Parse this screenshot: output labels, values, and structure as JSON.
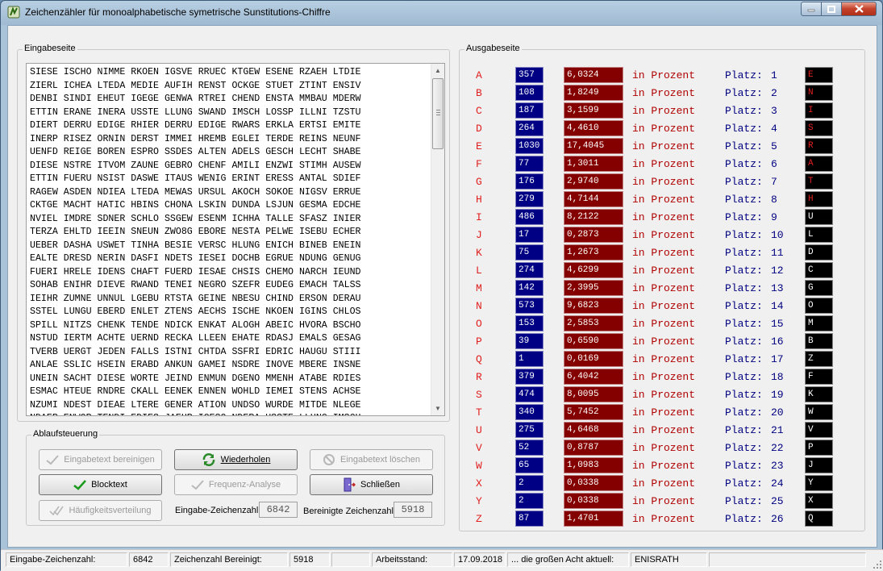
{
  "window": {
    "title": "Zeichenzähler für monoalphabetische symetrische Sunstitutions-Chiffre"
  },
  "input_panel": {
    "legend": "Eingabeseite",
    "lines": [
      "SIESE ISCHO NIMME RKOEN IGSVE RRUEC KTGEW ESENE RZAEH LTDIE",
      "ZIERL ICHEA LTEDA MEDIE AUFIH RENST OCKGE STUET ZTINT ENSIV",
      "DENBI SINDI EHEUT IGEGE GENWA RTREI CHEND ENSTA MMBAU MDERW",
      "ETTIN ERANE INERA USSTE LLUNG SWAND IMSCH LOSSP ILLNI TZSTU",
      "DIERT DERRU EDIGE RHIER DERRU EDIGE RWARS ERKLA ERTSI EMITE",
      "INERP RISEZ ORNIN DERST IMMEI HREMB EGLEI TERDE REINS NEUNF",
      "UENFD REIGE BOREN ESPRO SSDES ALTEN ADELS GESCH LECHT SHABE",
      "DIESE NSTRE ITVOM ZAUNE GEBRO CHENF AMILI ENZWI STIMH AUSEW",
      "ETTIN FUERU NSIST DASWE ITAUS WENIG ERINT ERESS ANTAL SDIEF",
      "RAGEW ASDEN NDIEA LTEDA MEWAS URSUL AKOCH SOKOE NIGSV ERRUE",
      "CKTGE MACHT HATIC HBINS CHONA LSKIN DUNDA LSJUN GESMA EDCHE",
      "NVIEL IMDRE SDNER SCHLO SSGEW ESENM ICHHA TALLE SFASZ INIER",
      "TERZA EHLTD IEEIN SNEUN ZWO8G EBORE NESTA PELWE ISEBU ECHER",
      "UEBER DASHA USWET TINHA BESIE VERSC HLUNG ENICH BINEB ENEIN",
      "EALTE DRESD NERIN DASFI NDETS IESEI DOCHB EGRUE NDUNG GENUG",
      "FUERI HRELE IDENS CHAFT FUERD IESAE CHSIS CHEMO NARCH IEUND",
      "SOHAB ENIHR DIEVE RWAND TENEI NEGRO SZEFR EUDEG EMACH TALSS",
      "IEIHR ZUMNE UNNUL LGEBU RTSTA GEINE NBESU CHIND ERSON DERAU",
      "SSTEL LUNGU EBERD ENLET ZTENS AECHS ISCHE NKOEN IGINS CHLOS",
      "SPILL NITZS CHENK TENDE NDICK ENKAT ALOGH ABEIC HVORA BSCHO",
      "NSTUD IERTM ACHTE UERND RECKA LLEEN EHATE RDASJ EMALS GESAG",
      "TVERB UERGT JEDEN FALLS ISTNI CHTDA SSFRI EDRIC HAUGU STIII",
      "ANLAE SSLIC HSEIN ERABD ANKUN GAMEI NSDRE INOVE MBERE INSNE",
      "UNEIN SACHT DIESE WORTE JEIND ENMUN DGENO MMENH ATABE RDIES",
      "ESMAC HTEUE RNDRE CKALL EENEK ENNEN WOHLD IEMEI STENS ACHSE",
      "NZUMI NDEST DIEAE LTERE GENER ATION UNDSO WURDE MITDE NLEGE",
      "NDAER ENWOR TENDI EDIES JAEHR IGESO NDERA USSTE LLUNG IMSCH"
    ]
  },
  "control_panel": {
    "legend": "Ablaufsteuerung",
    "buttons": {
      "clean": "Eingabetext bereinigen",
      "repeat": "Wiederholen",
      "delete": "Eingabetext löschen",
      "block": "Blocktext",
      "freq": "Frequenz-Analyse",
      "close": "Schließen",
      "distribution": "Häufigkeitsverteilung"
    },
    "input_count_label": "Eingabe-Zeichenzahl",
    "input_count": "6842",
    "clean_count_label": "Bereinigte Zeichenzahl:",
    "clean_count": "5918"
  },
  "output_panel": {
    "legend": "Ausgabeseite",
    "in_percent_label": "in Prozent",
    "rank_label": "Platz:",
    "rows": [
      {
        "letter": "A",
        "count": "357",
        "percent": "6,0324",
        "rank": "1",
        "sub": "E",
        "sub_color": "#e02020"
      },
      {
        "letter": "B",
        "count": "108",
        "percent": "1,8249",
        "rank": "2",
        "sub": "N",
        "sub_color": "#e02020"
      },
      {
        "letter": "C",
        "count": "187",
        "percent": "3,1599",
        "rank": "3",
        "sub": "I",
        "sub_color": "#e02020"
      },
      {
        "letter": "D",
        "count": "264",
        "percent": "4,4610",
        "rank": "4",
        "sub": "S",
        "sub_color": "#e02020"
      },
      {
        "letter": "E",
        "count": "1030",
        "percent": "17,4045",
        "rank": "5",
        "sub": "R",
        "sub_color": "#e02020"
      },
      {
        "letter": "F",
        "count": "77",
        "percent": "1,3011",
        "rank": "6",
        "sub": "A",
        "sub_color": "#e02020"
      },
      {
        "letter": "G",
        "count": "176",
        "percent": "2,9740",
        "rank": "7",
        "sub": "T",
        "sub_color": "#e02020"
      },
      {
        "letter": "H",
        "count": "279",
        "percent": "4,7144",
        "rank": "8",
        "sub": "H",
        "sub_color": "#e02020"
      },
      {
        "letter": "I",
        "count": "486",
        "percent": "8,2122",
        "rank": "9",
        "sub": "U",
        "sub_color": "#ffffff"
      },
      {
        "letter": "J",
        "count": "17",
        "percent": "0,2873",
        "rank": "10",
        "sub": "L",
        "sub_color": "#ffffff"
      },
      {
        "letter": "K",
        "count": "75",
        "percent": "1,2673",
        "rank": "11",
        "sub": "D",
        "sub_color": "#ffffff"
      },
      {
        "letter": "L",
        "count": "274",
        "percent": "4,6299",
        "rank": "12",
        "sub": "C",
        "sub_color": "#ffffff"
      },
      {
        "letter": "M",
        "count": "142",
        "percent": "2,3995",
        "rank": "13",
        "sub": "G",
        "sub_color": "#ffffff"
      },
      {
        "letter": "N",
        "count": "573",
        "percent": "9,6823",
        "rank": "14",
        "sub": "O",
        "sub_color": "#ffffff"
      },
      {
        "letter": "O",
        "count": "153",
        "percent": "2,5853",
        "rank": "15",
        "sub": "M",
        "sub_color": "#ffffff"
      },
      {
        "letter": "P",
        "count": "39",
        "percent": "0,6590",
        "rank": "16",
        "sub": "B",
        "sub_color": "#ffffff"
      },
      {
        "letter": "Q",
        "count": "1",
        "percent": "0,0169",
        "rank": "17",
        "sub": "Z",
        "sub_color": "#ffffff"
      },
      {
        "letter": "R",
        "count": "379",
        "percent": "6,4042",
        "rank": "18",
        "sub": "F",
        "sub_color": "#ffffff"
      },
      {
        "letter": "S",
        "count": "474",
        "percent": "8,0095",
        "rank": "19",
        "sub": "K",
        "sub_color": "#ffffff"
      },
      {
        "letter": "T",
        "count": "340",
        "percent": "5,7452",
        "rank": "20",
        "sub": "W",
        "sub_color": "#ffffff"
      },
      {
        "letter": "U",
        "count": "275",
        "percent": "4,6468",
        "rank": "21",
        "sub": "V",
        "sub_color": "#ffffff"
      },
      {
        "letter": "V",
        "count": "52",
        "percent": "0,8787",
        "rank": "22",
        "sub": "P",
        "sub_color": "#ffffff"
      },
      {
        "letter": "W",
        "count": "65",
        "percent": "1,0983",
        "rank": "23",
        "sub": "J",
        "sub_color": "#ffffff"
      },
      {
        "letter": "X",
        "count": "2",
        "percent": "0,0338",
        "rank": "24",
        "sub": "Y",
        "sub_color": "#ffffff"
      },
      {
        "letter": "Y",
        "count": "2",
        "percent": "0,0338",
        "rank": "25",
        "sub": "X",
        "sub_color": "#ffffff"
      },
      {
        "letter": "Z",
        "count": "87",
        "percent": "1,4701",
        "rank": "26",
        "sub": "Q",
        "sub_color": "#ffffff"
      }
    ]
  },
  "statusbar": {
    "input_label": "Eingabe-Zeichenzahl:",
    "input_value": "6842",
    "clean_label": "Zeichenzahl Bereinigt:",
    "clean_value": "5918",
    "work_label": "Arbeitsstand:",
    "work_date": "17.09.2018",
    "eight_label": "... die großen Acht aktuell:",
    "eight_value": "ENISRATH"
  }
}
